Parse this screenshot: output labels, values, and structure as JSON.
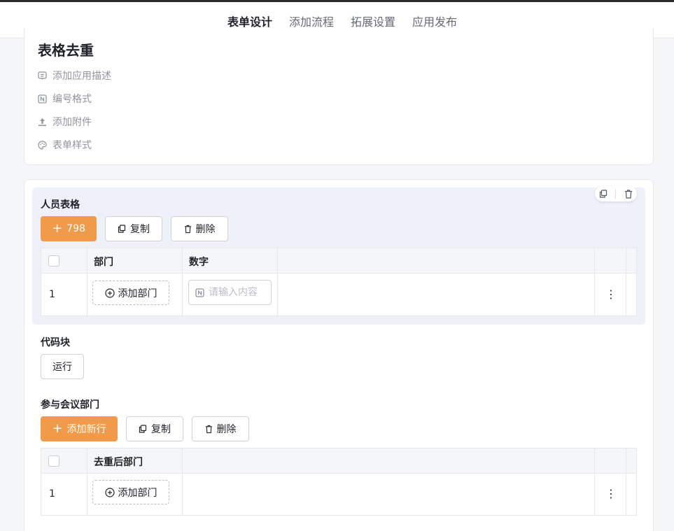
{
  "tabs": [
    {
      "label": "表单设计",
      "active": true
    },
    {
      "label": "添加流程",
      "active": false
    },
    {
      "label": "拓展设置",
      "active": false
    },
    {
      "label": "应用发布",
      "active": false
    }
  ],
  "app": {
    "title": "表格去重",
    "meta": [
      {
        "icon": "comment-icon",
        "label": "添加应用描述"
      },
      {
        "icon": "number-format-icon",
        "label": "编号格式"
      },
      {
        "icon": "upload-icon",
        "label": "添加附件"
      },
      {
        "icon": "palette-icon",
        "label": "表单样式"
      }
    ]
  },
  "table1": {
    "label": "人员表格",
    "add_label": "798",
    "copy_label": "复制",
    "delete_label": "删除",
    "columns": [
      "部门",
      "数字"
    ],
    "row_number": "1",
    "add_dept_label": "添加部门",
    "number_placeholder": "请输入内容"
  },
  "code_block": {
    "label": "代码块",
    "run_label": "运行"
  },
  "table2": {
    "label": "参与会议部门",
    "add_label": "添加新行",
    "copy_label": "复制",
    "delete_label": "删除",
    "columns": [
      "去重后部门"
    ],
    "row_number": "1",
    "add_dept_label": "添加部门"
  },
  "colors": {
    "accent": "#f09a4a",
    "selected_bg": "#eef0fa"
  }
}
